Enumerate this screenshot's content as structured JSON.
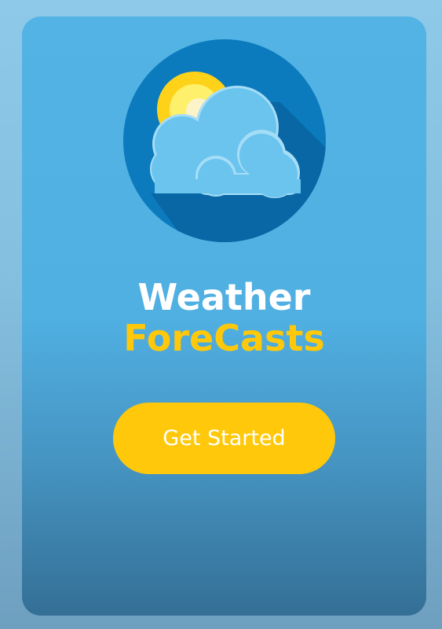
{
  "colors": {
    "page_background": "#8ec9e9",
    "card_top": "#52b3e4",
    "card_bottom": "#346f95",
    "accent": "#ffc80a",
    "title_primary": "#ffffff",
    "logo_circle": "#0b7bbe",
    "cloud": "#6ac4ee",
    "sun": "#ffd21a"
  },
  "logo": {
    "icon": "sun-behind-cloud-icon"
  },
  "hero": {
    "title_line1": "Weather",
    "title_line2": "ForeCasts"
  },
  "cta": {
    "label": "Get Started"
  }
}
